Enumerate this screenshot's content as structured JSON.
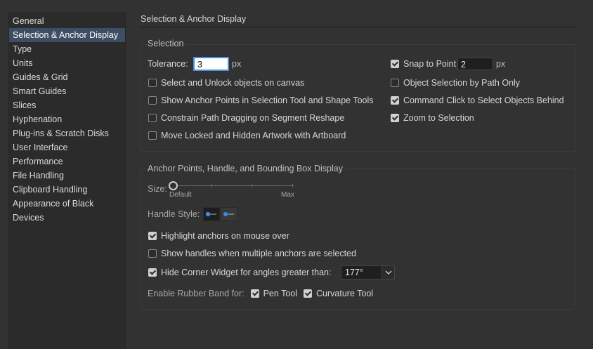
{
  "sidebar": {
    "items": [
      {
        "label": "General"
      },
      {
        "label": "Selection & Anchor Display"
      },
      {
        "label": "Type"
      },
      {
        "label": "Units"
      },
      {
        "label": "Guides & Grid"
      },
      {
        "label": "Smart Guides"
      },
      {
        "label": "Slices"
      },
      {
        "label": "Hyphenation"
      },
      {
        "label": "Plug-ins & Scratch Disks"
      },
      {
        "label": "User Interface"
      },
      {
        "label": "Performance"
      },
      {
        "label": "File Handling"
      },
      {
        "label": "Clipboard Handling"
      },
      {
        "label": "Appearance of Black"
      },
      {
        "label": "Devices"
      }
    ],
    "selected_index": 1
  },
  "page": {
    "title": "Selection & Anchor Display"
  },
  "selection": {
    "title": "Selection",
    "tolerance_label": "Tolerance:",
    "tolerance_value": "3",
    "tolerance_unit": "px",
    "snap_to_point": {
      "label": "Snap to Point",
      "checked": true,
      "value": "2",
      "unit": "px"
    },
    "select_unlock": {
      "label": "Select and Unlock objects on canvas",
      "checked": false
    },
    "object_selection_path": {
      "label": "Object Selection by Path Only",
      "checked": false
    },
    "show_anchor_points": {
      "label": "Show Anchor Points in Selection Tool and Shape Tools",
      "checked": false
    },
    "command_click": {
      "label": "Command Click to Select Objects Behind",
      "checked": true
    },
    "constrain_path": {
      "label": "Constrain Path Dragging on Segment Reshape",
      "checked": false
    },
    "zoom_to_selection": {
      "label": "Zoom to Selection",
      "checked": true
    },
    "move_locked": {
      "label": "Move Locked and Hidden Artwork with Artboard",
      "checked": false
    }
  },
  "anchor": {
    "title": "Anchor Points, Handle, and Bounding Box Display",
    "size_label": "Size:",
    "size_min_label": "Default",
    "size_max_label": "Max",
    "size_value_fraction": 0,
    "handle_style_label": "Handle Style:",
    "handle_style_selected": 0,
    "highlight_anchors": {
      "label": "Highlight anchors on mouse over",
      "checked": true
    },
    "show_handles_multiple": {
      "label": "Show handles when multiple anchors are selected",
      "checked": false
    },
    "hide_corner_widget": {
      "label": "Hide Corner Widget for angles greater than:",
      "checked": true,
      "value": "177°"
    },
    "rubber_band_label": "Enable Rubber Band for:",
    "pen_tool": {
      "label": "Pen Tool",
      "checked": true
    },
    "curvature_tool": {
      "label": "Curvature Tool",
      "checked": true
    }
  },
  "colors": {
    "background": "#323232",
    "sidebar_bg": "#2b2b2b",
    "selected_item": "#3d4d64",
    "focus_ring": "#4a8fe0",
    "handle_accent": "#3b8be8"
  }
}
